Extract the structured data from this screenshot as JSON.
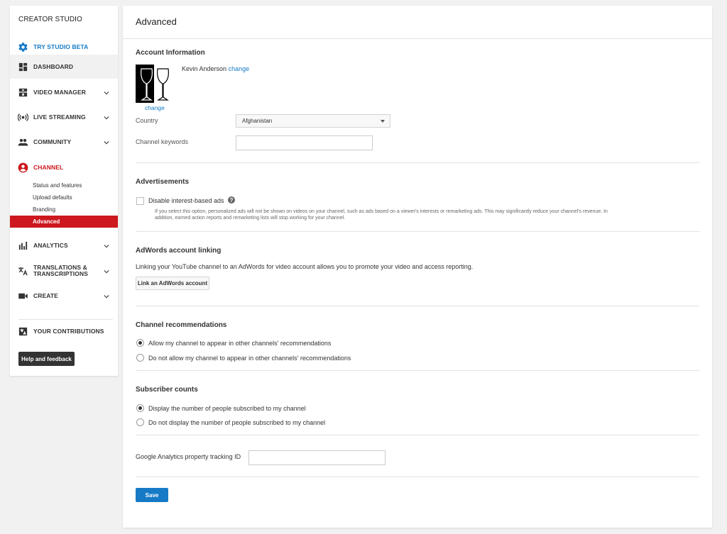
{
  "sidebar": {
    "title": "CREATOR STUDIO",
    "items": [
      {
        "label": "TRY STUDIO BETA",
        "icon": "gear-icon"
      },
      {
        "label": "DASHBOARD",
        "icon": "dashboard-icon"
      },
      {
        "label": "VIDEO MANAGER",
        "icon": "video-manager-icon"
      },
      {
        "label": "LIVE STREAMING",
        "icon": "live-streaming-icon"
      },
      {
        "label": "COMMUNITY",
        "icon": "community-icon"
      },
      {
        "label": "CHANNEL",
        "icon": "channel-account-icon"
      },
      {
        "label": "ANALYTICS",
        "icon": "analytics-bars-icon"
      },
      {
        "label": "TRANSLATIONS &",
        "label2": "TRANSCRIPTIONS",
        "icon": "translate-icon"
      },
      {
        "label": "CREATE",
        "icon": "camera-icon"
      },
      {
        "label": "YOUR CONTRIBUTIONS",
        "icon": "contributions-icon"
      }
    ],
    "channel_sub": [
      "Status and features",
      "Upload defaults",
      "Branding",
      "Advanced"
    ],
    "help_label": "Help and feedback"
  },
  "main": {
    "title": "Advanced",
    "account": {
      "heading": "Account Information",
      "name": "Kevin Anderson",
      "change_name": "change",
      "change_avatar": "change",
      "country_label": "Country",
      "country_value": "Afghanistan",
      "keywords_label": "Channel keywords",
      "keywords_value": ""
    },
    "ads": {
      "heading": "Advertisements",
      "checkbox_label": "Disable interest-based ads",
      "checked": false,
      "help": "?",
      "description": "If you select this option, personalized ads will not be shown on videos on your channel, such as ads based on a viewer's interests or remarketing ads. This may significantly reduce your channel's revenue. In addition, earned action reports and remarketing lists will stop working for your channel."
    },
    "adwords": {
      "heading": "AdWords account linking",
      "text": "Linking your YouTube channel to an AdWords for video account allows you to promote your video and access reporting.",
      "button": "Link an AdWords account"
    },
    "recommendations": {
      "heading": "Channel recommendations",
      "options": [
        "Allow my channel to appear in other channels' recommendations",
        "Do not allow my channel to appear in other channels' recommendations"
      ],
      "selected": 0
    },
    "subscribers": {
      "heading": "Subscriber counts",
      "options": [
        "Display the number of people subscribed to my channel",
        "Do not display the number of people subscribed to my channel"
      ],
      "selected": 0
    },
    "analytics": {
      "label": "Google Analytics property tracking ID",
      "value": ""
    },
    "save_label": "Save"
  },
  "colors": {
    "accent_blue": "#167ac6",
    "channel_red": "#cc181e",
    "background": "#f1f1f1"
  }
}
